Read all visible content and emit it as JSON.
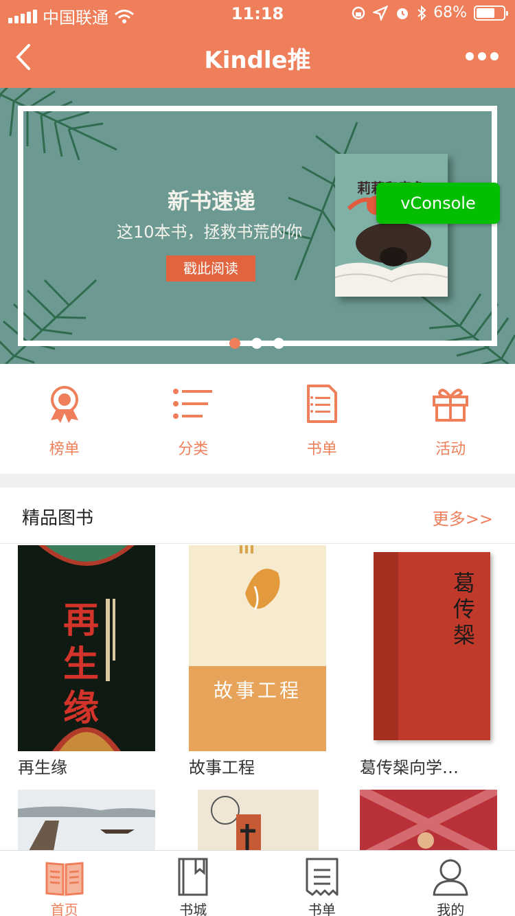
{
  "status": {
    "carrier": "中国联通",
    "time": "11:18",
    "battery": "68%",
    "battery_level": 0.68
  },
  "nav": {
    "title": "Kindle推"
  },
  "banner": {
    "heading": "新书速递",
    "sub": "这10本书，拯救书荒的你",
    "button": "戳此阅读",
    "book_title": "莉莉和章鱼",
    "vconsole": "vConsole"
  },
  "quick": [
    {
      "label": "榜单",
      "icon": "ribbon-medal-icon"
    },
    {
      "label": "分类",
      "icon": "list-icon"
    },
    {
      "label": "书单",
      "icon": "document-list-icon"
    },
    {
      "label": "活动",
      "icon": "gift-icon"
    }
  ],
  "section": {
    "title": "精品图书",
    "more": "更多>>",
    "books": [
      {
        "name": "再生缘",
        "cover_text": "再生缘"
      },
      {
        "name": "故事工程",
        "cover_text": "故事工程"
      },
      {
        "name": "葛传椝向学…",
        "cover_text": "葛传椝"
      }
    ]
  },
  "tabs": [
    {
      "label": "首页",
      "icon": "open-book-icon",
      "active": true
    },
    {
      "label": "书城",
      "icon": "book-icon",
      "active": false
    },
    {
      "label": "书单",
      "icon": "receipt-icon",
      "active": false
    },
    {
      "label": "我的",
      "icon": "user-icon",
      "active": false
    }
  ],
  "colors": {
    "accent": "#ee7f5a",
    "banner_bg": "#6c9a92",
    "vconsole": "#04be02"
  }
}
